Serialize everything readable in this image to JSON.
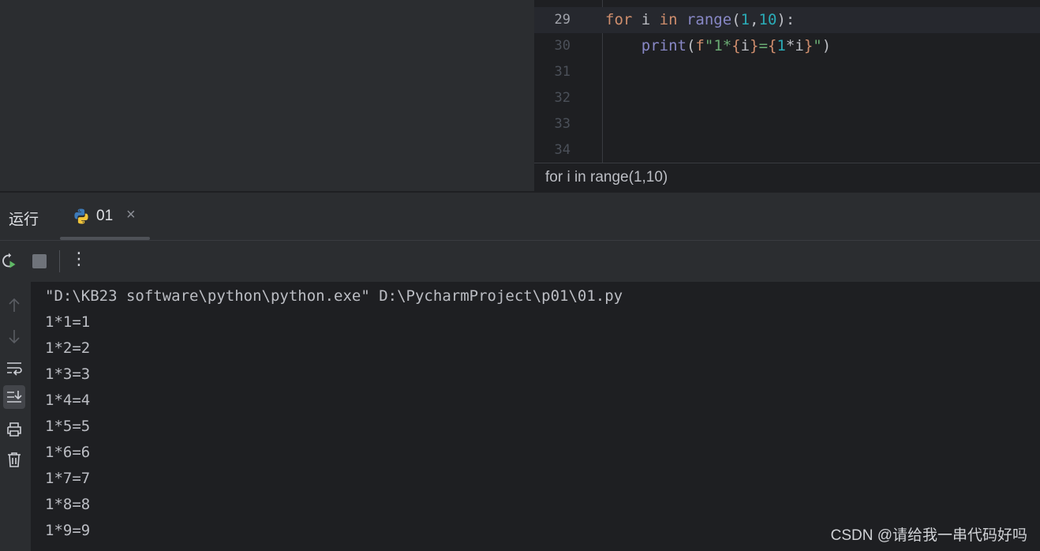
{
  "editor": {
    "lines": [
      {
        "num": "29",
        "current": true
      },
      {
        "num": "30",
        "current": false
      },
      {
        "num": "31",
        "current": false
      },
      {
        "num": "32",
        "current": false
      },
      {
        "num": "33",
        "current": false
      },
      {
        "num": "34",
        "current": false
      }
    ],
    "code_line_29": {
      "kw_for": "for",
      "var_i": " i ",
      "kw_in": "in",
      "fn_range": " range",
      "open": "(",
      "n1": "1",
      "comma": ",",
      "n10": "10",
      "close": "):"
    },
    "code_line_30": {
      "indent": "    ",
      "fn_print": "print",
      "open": "(",
      "prefix": "f",
      "str_a": "\"1*",
      "b1_open": "{",
      "expr1": "i",
      "b1_close": "}",
      "str_b": "=",
      "b2_open": "{",
      "expr2_num": "1",
      "expr2_rest": "*i",
      "b2_close": "}",
      "str_c": "\"",
      "close": ")"
    },
    "breadcrumb": "for i in range(1,10)"
  },
  "run_panel": {
    "title": "运行",
    "tab_label": "01",
    "tab_close": "×",
    "more_label": "⋮"
  },
  "console": {
    "lines": [
      "\"D:\\KB23 software\\python\\python.exe\" D:\\PycharmProject\\p01\\01.py",
      "1*1=1",
      "1*2=2",
      "1*3=3",
      "1*4=4",
      "1*5=5",
      "1*6=6",
      "1*7=7",
      "1*8=8",
      "1*9=9"
    ]
  },
  "watermark": "CSDN @请给我一串代码好吗",
  "colors": {
    "editor_bg": "#1e1f22",
    "panel_bg": "#2b2d30",
    "keyword": "#cf8e6d",
    "function": "#8888c6",
    "number": "#2aacb8",
    "string": "#6aab73",
    "text": "#bcbec4"
  },
  "icons": {
    "rerun": "rerun-icon",
    "stop": "stop-icon",
    "more": "more-vertical-icon",
    "up": "arrow-up-icon",
    "down": "arrow-down-icon",
    "soft_wrap": "soft-wrap-icon",
    "scroll_to_end": "scroll-to-end-icon",
    "print": "printer-icon",
    "clear": "trash-icon",
    "python": "python-icon"
  }
}
